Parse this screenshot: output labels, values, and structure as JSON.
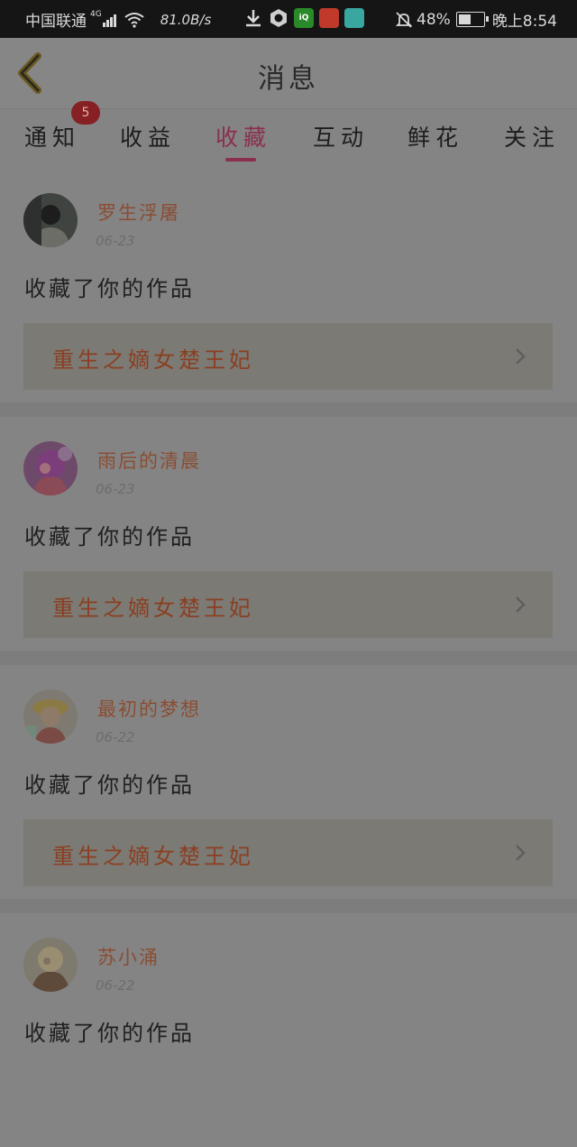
{
  "status_bar": {
    "carrier": "中国联通",
    "network_gen": "4G",
    "speed": "81.0B/s",
    "battery": "48%",
    "time": "晚上8:54",
    "app_icons": [
      "download-icon",
      "browser-icon",
      "iqiyi-icon",
      "app-red-icon",
      "app-teal-icon"
    ]
  },
  "header": {
    "title": "消息"
  },
  "tabs": [
    {
      "label": "通知"
    },
    {
      "label": "收益"
    },
    {
      "label": "收藏",
      "active": true
    },
    {
      "label": "互动"
    },
    {
      "label": "鲜花"
    },
    {
      "label": "关注"
    }
  ],
  "notification_badge": "5",
  "items": [
    {
      "user": "罗生浮屠",
      "date": "06-23",
      "action": "收藏了你的作品",
      "work": "重生之嫡女楚王妃"
    },
    {
      "user": "雨后的清晨",
      "date": "06-23",
      "action": "收藏了你的作品",
      "work": "重生之嫡女楚王妃"
    },
    {
      "user": "最初的梦想",
      "date": "06-22",
      "action": "收藏了你的作品",
      "work": "重生之嫡女楚王妃"
    },
    {
      "user": "苏小涌",
      "date": "06-22",
      "action": "收藏了你的作品",
      "work": ""
    }
  ],
  "colors": {
    "accent": "#8a2f4e",
    "username": "#8a4d33",
    "work_title": "#8a3f22",
    "overlay_bg": "#848484"
  }
}
